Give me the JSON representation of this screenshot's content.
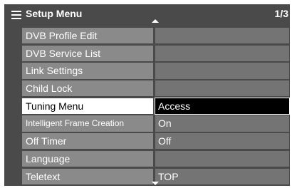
{
  "header": {
    "title": "Setup Menu",
    "page": "1/3",
    "icon": "menu-list-icon"
  },
  "items": [
    {
      "label": "DVB Profile Edit",
      "value": ""
    },
    {
      "label": "DVB Service List",
      "value": ""
    },
    {
      "label": "Link Settings",
      "value": ""
    },
    {
      "label": "Child Lock",
      "value": ""
    },
    {
      "label": "Tuning Menu",
      "value": "Access",
      "selected": true
    },
    {
      "label": "Intelligent Frame Creation",
      "value": "On"
    },
    {
      "label": "Off Timer",
      "value": "Off"
    },
    {
      "label": "Language",
      "value": ""
    },
    {
      "label": "Teletext",
      "value": "TOP"
    }
  ],
  "colors": {
    "background": "#4a4a4a",
    "label": "#8a8a8a",
    "value": "#747474",
    "selected_label": "#ffffff",
    "selected_value": "#000000"
  }
}
